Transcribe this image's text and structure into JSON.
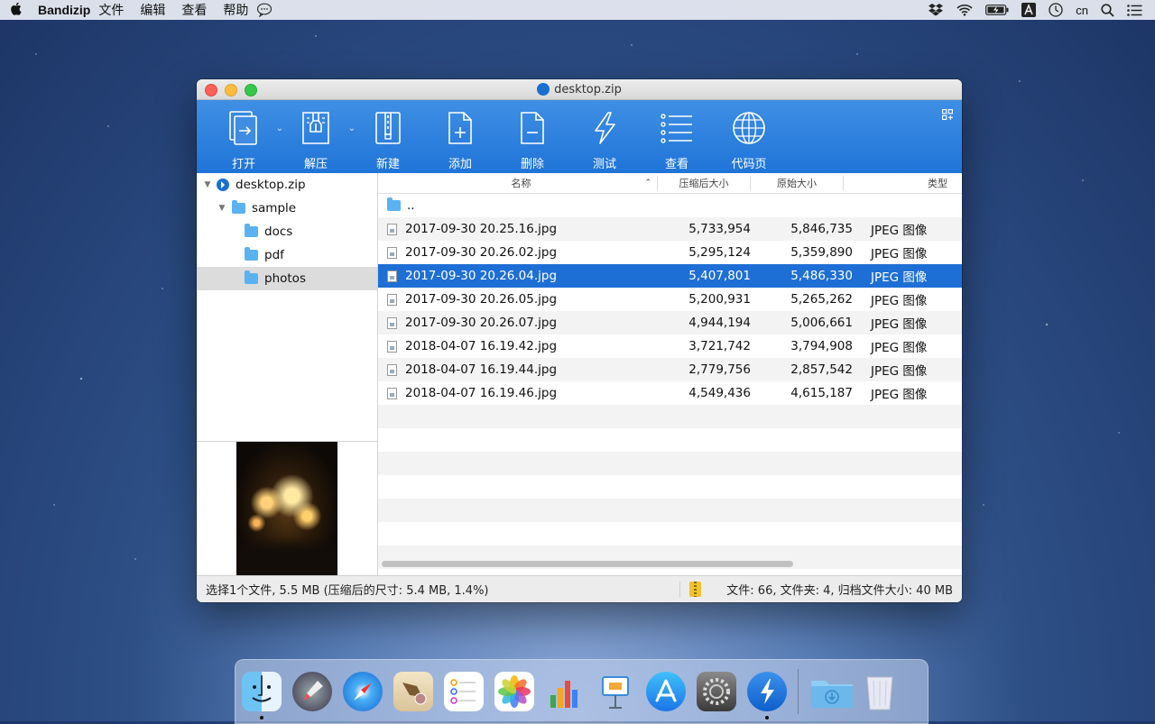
{
  "menubar": {
    "app_name": "Bandizip",
    "items": [
      "文件",
      "编辑",
      "查看",
      "帮助"
    ],
    "input_source": "cn"
  },
  "window": {
    "title": "desktop.zip"
  },
  "toolbar": {
    "buttons": [
      {
        "label": "打开",
        "icon": "open-icon"
      },
      {
        "label": "解压",
        "icon": "extract-icon"
      },
      {
        "label": "新建",
        "icon": "new-archive-icon"
      },
      {
        "label": "添加",
        "icon": "add-file-icon"
      },
      {
        "label": "删除",
        "icon": "delete-file-icon"
      },
      {
        "label": "测试",
        "icon": "test-icon"
      },
      {
        "label": "查看",
        "icon": "view-list-icon"
      },
      {
        "label": "代码页",
        "icon": "codepage-globe-icon"
      }
    ]
  },
  "tree": {
    "root": "desktop.zip",
    "folder": "sample",
    "children": [
      "docs",
      "pdf",
      "photos"
    ],
    "selected": "photos"
  },
  "columns": {
    "name": "名称",
    "compressed": "压缩后大小",
    "original": "原始大小",
    "type": "类型"
  },
  "files": [
    {
      "name": "..",
      "compressed": "",
      "original": "",
      "type": ""
    },
    {
      "name": "2017-09-30 20.25.16.jpg",
      "compressed": "5,733,954",
      "original": "5,846,735",
      "type": "JPEG 图像"
    },
    {
      "name": "2017-09-30 20.26.02.jpg",
      "compressed": "5,295,124",
      "original": "5,359,890",
      "type": "JPEG 图像"
    },
    {
      "name": "2017-09-30 20.26.04.jpg",
      "compressed": "5,407,801",
      "original": "5,486,330",
      "type": "JPEG 图像"
    },
    {
      "name": "2017-09-30 20.26.05.jpg",
      "compressed": "5,200,931",
      "original": "5,265,262",
      "type": "JPEG 图像"
    },
    {
      "name": "2017-09-30 20.26.07.jpg",
      "compressed": "4,944,194",
      "original": "5,006,661",
      "type": "JPEG 图像"
    },
    {
      "name": "2018-04-07 16.19.42.jpg",
      "compressed": "3,721,742",
      "original": "3,794,908",
      "type": "JPEG 图像"
    },
    {
      "name": "2018-04-07 16.19.44.jpg",
      "compressed": "2,779,756",
      "original": "2,857,542",
      "type": "JPEG 图像"
    },
    {
      "name": "2018-04-07 16.19.46.jpg",
      "compressed": "4,549,436",
      "original": "4,615,187",
      "type": "JPEG 图像"
    }
  ],
  "selected_file": "2017-09-30 20.26.04.jpg",
  "status": {
    "selection": "选择1个文件, 5.5 MB (压缩后的尺寸: 5.4 MB, 1.4%)",
    "summary": "文件: 66, 文件夹: 4, 归档文件大小: 40 MB"
  },
  "dock": {
    "apps": [
      "finder-icon",
      "launchpad-icon",
      "safari-icon",
      "mail-icon",
      "reminders-icon",
      "photos-icon",
      "numbers-icon",
      "keynote-icon",
      "app-store-icon",
      "system-preferences-icon",
      "bandizip-icon"
    ],
    "extras": [
      "downloads-folder-icon",
      "trash-icon"
    ]
  },
  "colors": {
    "toolbar_blue": "#2a7fdd",
    "selection_blue": "#1e6fd5",
    "folder_blue": "#5ab2f1"
  }
}
